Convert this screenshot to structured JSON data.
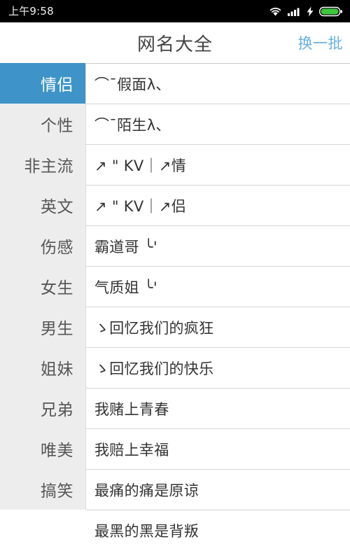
{
  "statusbar": {
    "time": "上午9:58",
    "icons": [
      "wifi-icon",
      "cellular-signal-icon",
      "charging-bolt-icon",
      "battery-icon"
    ],
    "battery_color": "#3ec63e",
    "background": "#000000"
  },
  "header": {
    "title": "网名大全",
    "action_label": "换一批",
    "action_color": "#68b0dd",
    "title_color": "#444444"
  },
  "sidebar": {
    "active_index": 0,
    "active_background": "#3e93c8",
    "background": "#ededed",
    "items": [
      {
        "label": "情侣"
      },
      {
        "label": "个性"
      },
      {
        "label": "非主流"
      },
      {
        "label": "英文"
      },
      {
        "label": "伤感"
      },
      {
        "label": "女生"
      },
      {
        "label": "男生"
      },
      {
        "label": "姐妹"
      },
      {
        "label": "兄弟"
      },
      {
        "label": "唯美"
      },
      {
        "label": "搞笑"
      }
    ]
  },
  "list": {
    "rows": [
      {
        "text": "⌒ˉ假面λ、"
      },
      {
        "text": "⌒ˉ陌生λ、"
      },
      {
        "text": "↗ \" KV｜↗情"
      },
      {
        "text": "↗ \" KV｜↗侣"
      },
      {
        "text": "霸道哥 ╰'"
      },
      {
        "text": "气质姐 ╰'"
      },
      {
        "text": "ゝ回忆我们的疯狂"
      },
      {
        "text": "ゝ回忆我们的快乐"
      },
      {
        "text": "我赌上青春"
      },
      {
        "text": "我赔上幸福"
      },
      {
        "text": "最痛的痛是原谅"
      },
      {
        "text": "最黑的黑是背叛"
      }
    ]
  }
}
